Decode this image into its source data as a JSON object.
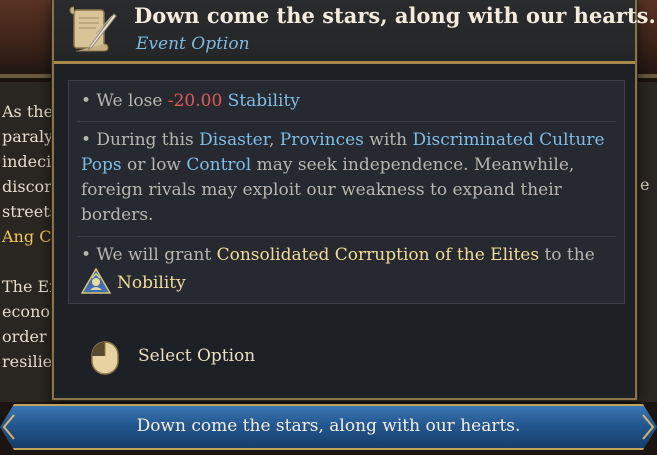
{
  "background": {
    "left_lines": [
      "As the",
      "paraly",
      "indeci",
      "discor",
      "streets",
      "Ang Cl",
      "",
      "The Er",
      "econo",
      "order",
      "resilie"
    ],
    "right_fragment": "e"
  },
  "tooltip": {
    "title": "Down come the stars, along with our hearts.",
    "subtitle": "Event Option",
    "effects": {
      "stability": {
        "prefix": "• We lose ",
        "value": "-20.00",
        "keyword": "Stability"
      },
      "disaster": {
        "p1": "• During this ",
        "k1": "Disaster",
        "p2": ", ",
        "k2": "Provinces",
        "p3": " with ",
        "k3": "Discriminated Culture Pops",
        "p4": " or low ",
        "k4": "Control",
        "p5": " may seek independence. Meanwhile, foreign rivals may exploit our weakness to expand their borders."
      },
      "corruption": {
        "p1": "• We will grant ",
        "k1": "Consolidated Corruption of the Elites",
        "p2": " to the",
        "estate": "Nobility"
      }
    },
    "select_label": "Select Option"
  },
  "option_button": {
    "label": "Down come the stars, along with our hearts."
  },
  "colors": {
    "keyword_blue": "#7fbde6",
    "negative_red": "#e2594f",
    "gold_text": "#f0dc98",
    "border_gold": "#a8894c"
  }
}
